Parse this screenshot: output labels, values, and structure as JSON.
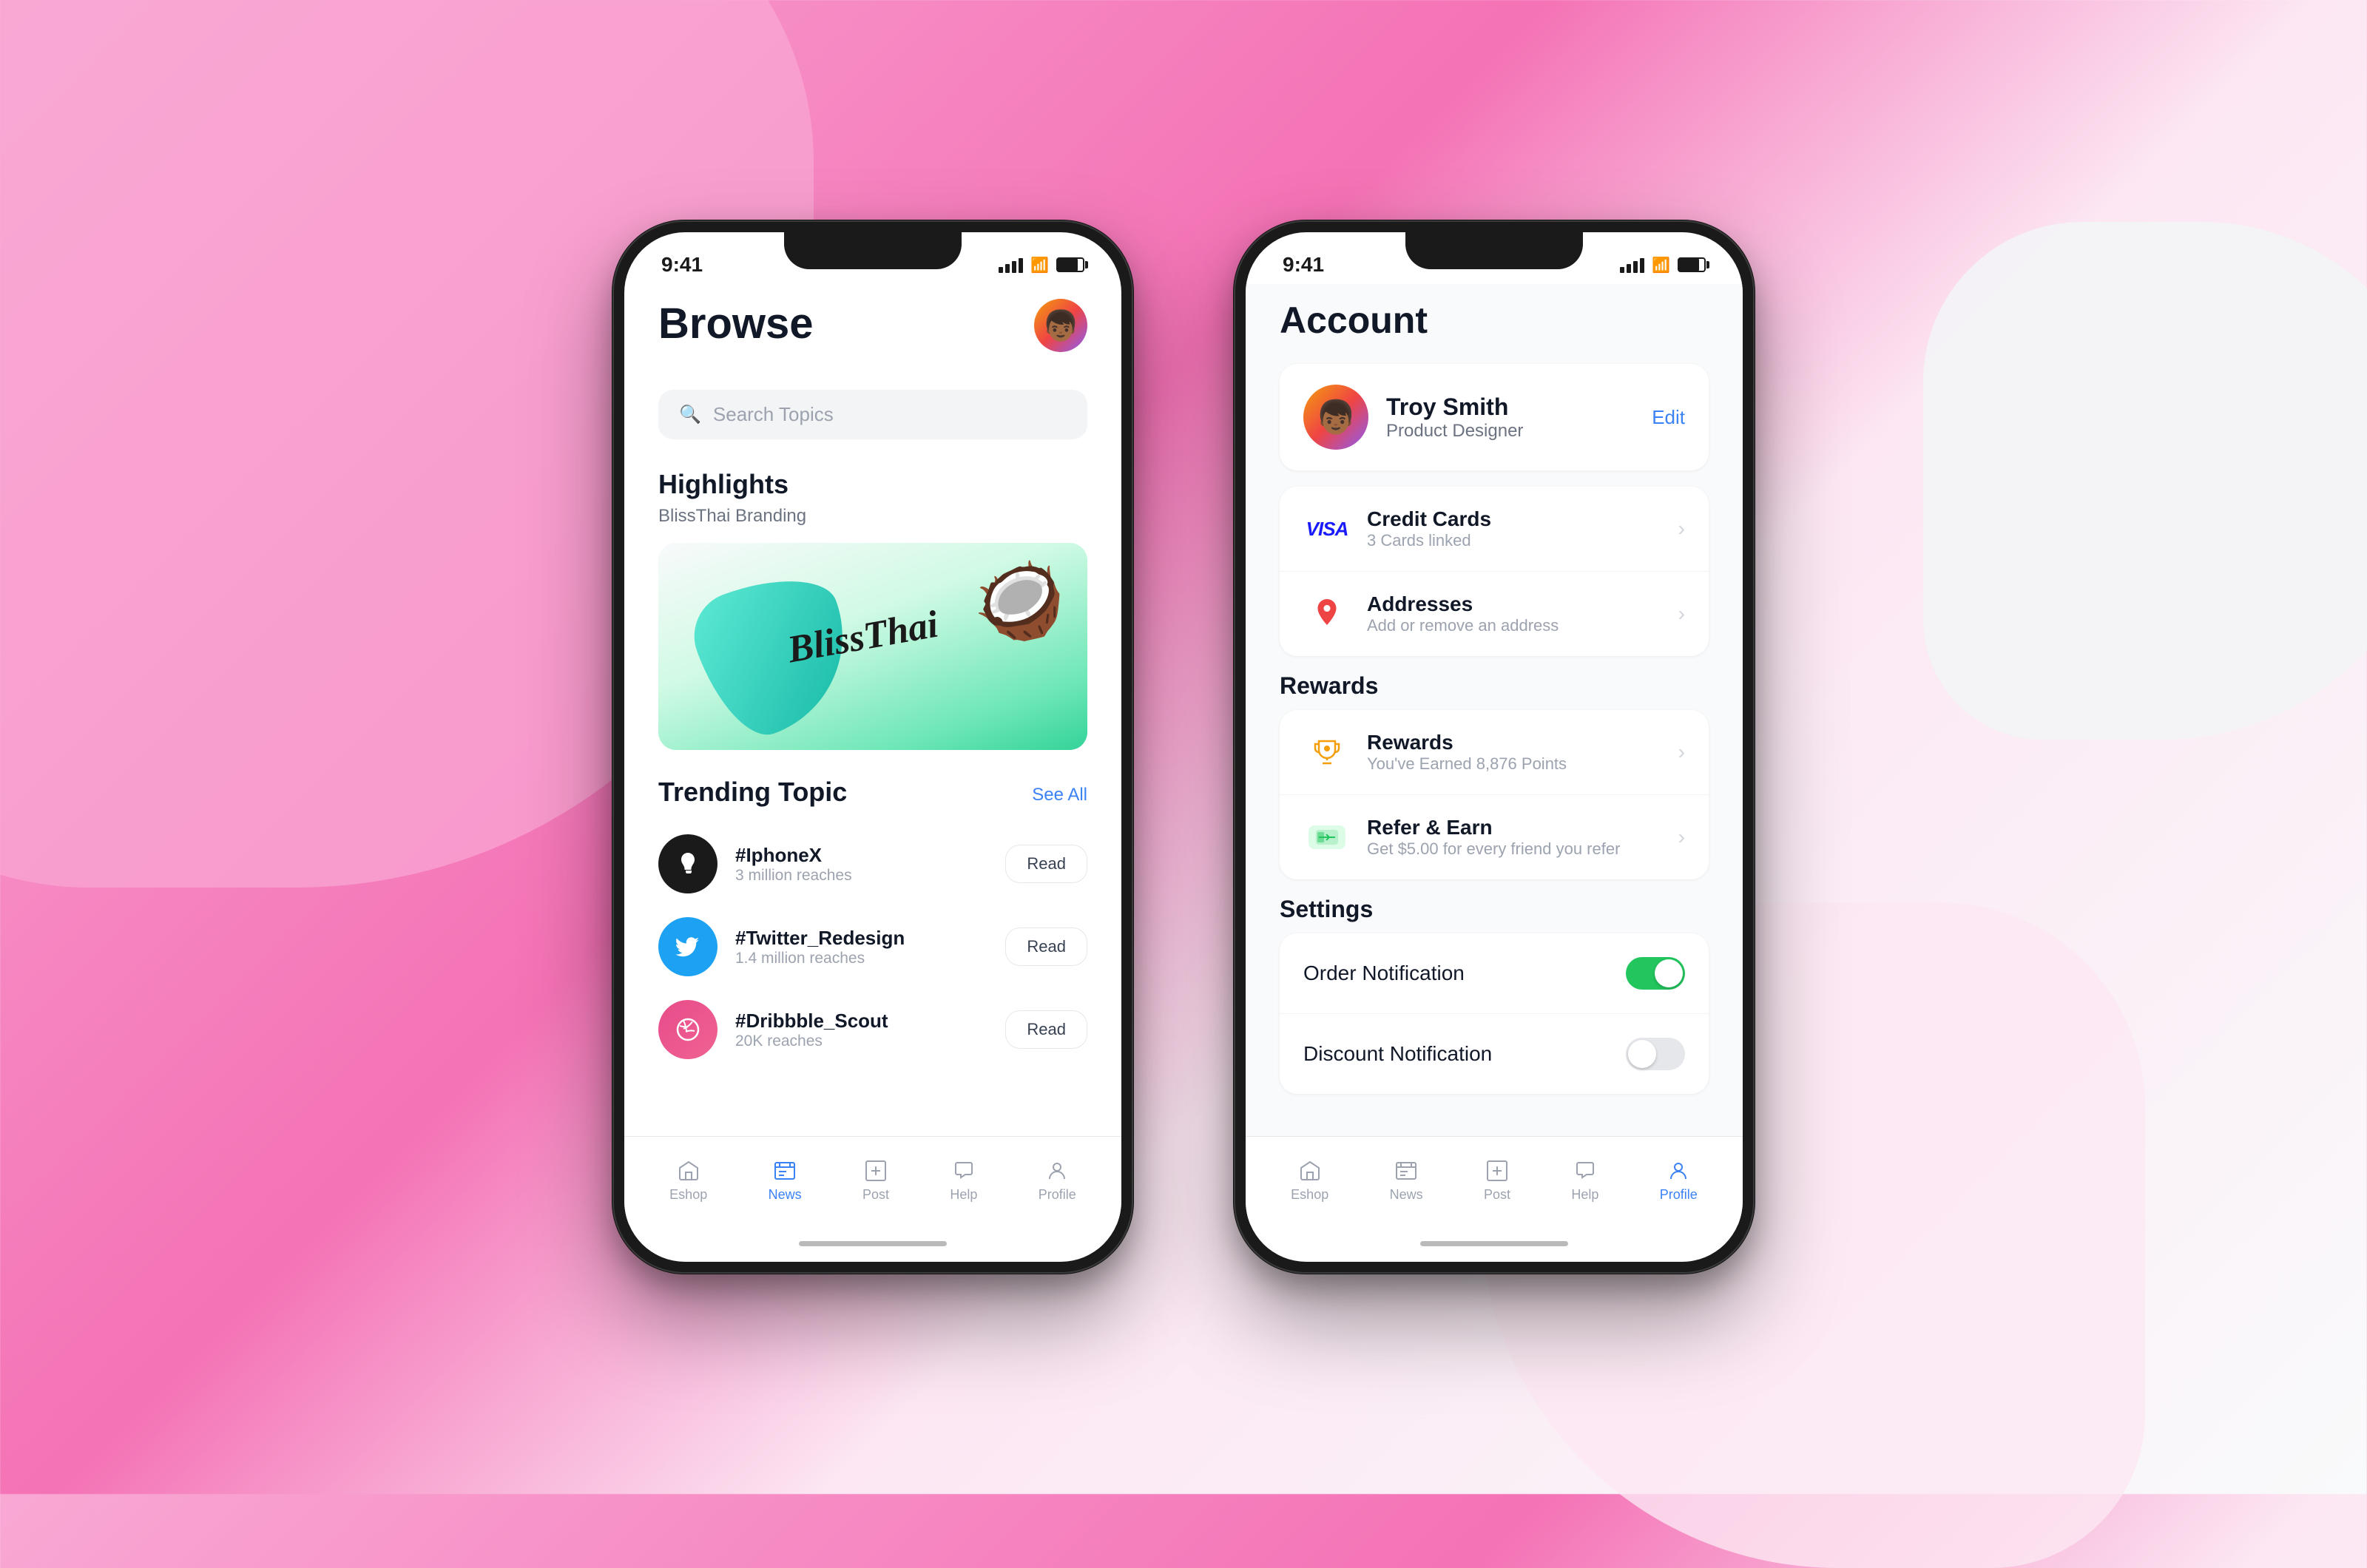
{
  "background": {
    "color1": "#f9a8d4",
    "color2": "#f472b6"
  },
  "phone1": {
    "status_time": "9:41",
    "screen": "browse",
    "title": "Browse",
    "search_placeholder": "Search Topics",
    "highlights_title": "Highlights",
    "highlights_subtitle": "BlissThai Branding",
    "highlights_text": "BlissThai",
    "trending_title": "Trending Topic",
    "see_all": "See All",
    "topics": [
      {
        "name": "#IphoneX",
        "reach": "3 million reaches",
        "platform": "apple"
      },
      {
        "name": "#Twitter_Redesign",
        "reach": "1.4 million reaches",
        "platform": "twitter"
      },
      {
        "name": "#Dribbble_Scout",
        "reach": "20K reaches",
        "platform": "dribbble"
      }
    ],
    "read_label": "Read",
    "tab_bar": [
      {
        "label": "Eshop",
        "icon": "🏠",
        "active": false
      },
      {
        "label": "News",
        "icon": "📰",
        "active": true
      },
      {
        "label": "Post",
        "icon": "📥",
        "active": false
      },
      {
        "label": "Help",
        "icon": "💬",
        "active": false
      },
      {
        "label": "Profile",
        "icon": "👤",
        "active": false
      }
    ]
  },
  "phone2": {
    "status_time": "9:41",
    "screen": "account",
    "title": "Account",
    "profile": {
      "name": "Troy Smith",
      "role": "Product Designer",
      "edit_label": "Edit"
    },
    "credit_cards": {
      "title": "Credit Cards",
      "subtitle": "3 Cards linked"
    },
    "addresses": {
      "title": "Addresses",
      "subtitle": "Add or remove an address"
    },
    "rewards_section_label": "Rewards",
    "rewards": {
      "title": "Rewards",
      "subtitle": "You've Earned 8,876 Points"
    },
    "refer": {
      "title": "Refer & Earn",
      "subtitle": "Get $5.00 for every friend you refer"
    },
    "settings_section_label": "Settings",
    "order_notification": {
      "label": "Order Notification",
      "enabled": true
    },
    "discount_notification": {
      "label": "Discount Notification",
      "enabled": false
    },
    "tab_bar": [
      {
        "label": "Eshop",
        "icon": "🏠",
        "active": false
      },
      {
        "label": "News",
        "icon": "📰",
        "active": false
      },
      {
        "label": "Post",
        "icon": "📥",
        "active": false
      },
      {
        "label": "Help",
        "icon": "💬",
        "active": false
      },
      {
        "label": "Profile",
        "icon": "👤",
        "active": true
      }
    ]
  }
}
